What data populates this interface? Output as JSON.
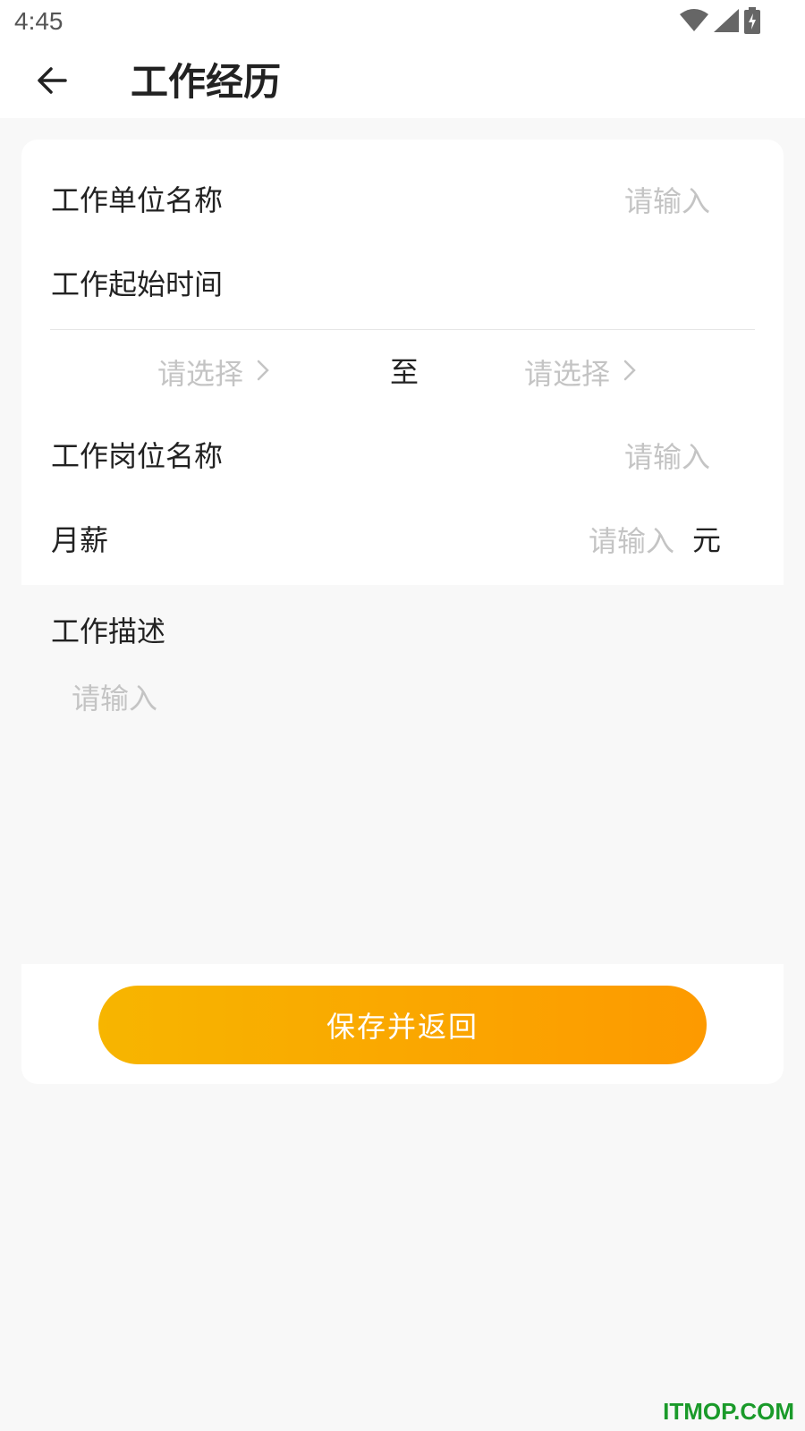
{
  "status_bar": {
    "time": "4:45"
  },
  "header": {
    "title": "工作经历"
  },
  "form": {
    "company": {
      "label": "工作单位名称",
      "placeholder": "请输入"
    },
    "work_period": {
      "label": "工作起始时间",
      "start_placeholder": "请选择",
      "separator": "至",
      "end_placeholder": "请选择"
    },
    "position": {
      "label": "工作岗位名称",
      "placeholder": "请输入"
    },
    "salary": {
      "label": "月薪",
      "placeholder": "请输入",
      "unit": "元"
    },
    "description": {
      "label": "工作描述",
      "placeholder": "请输入"
    }
  },
  "actions": {
    "save_label": "保存并返回"
  },
  "watermark": "ITMOP.COM",
  "colors": {
    "accent_start": "#f7b500",
    "accent_end": "#fd9a00",
    "placeholder": "#c4c4c4",
    "watermark": "#1a9a2a"
  },
  "icons": [
    "back-arrow-icon",
    "wifi-icon",
    "signal-icon",
    "battery-charging-icon",
    "chevron-right-icon"
  ]
}
